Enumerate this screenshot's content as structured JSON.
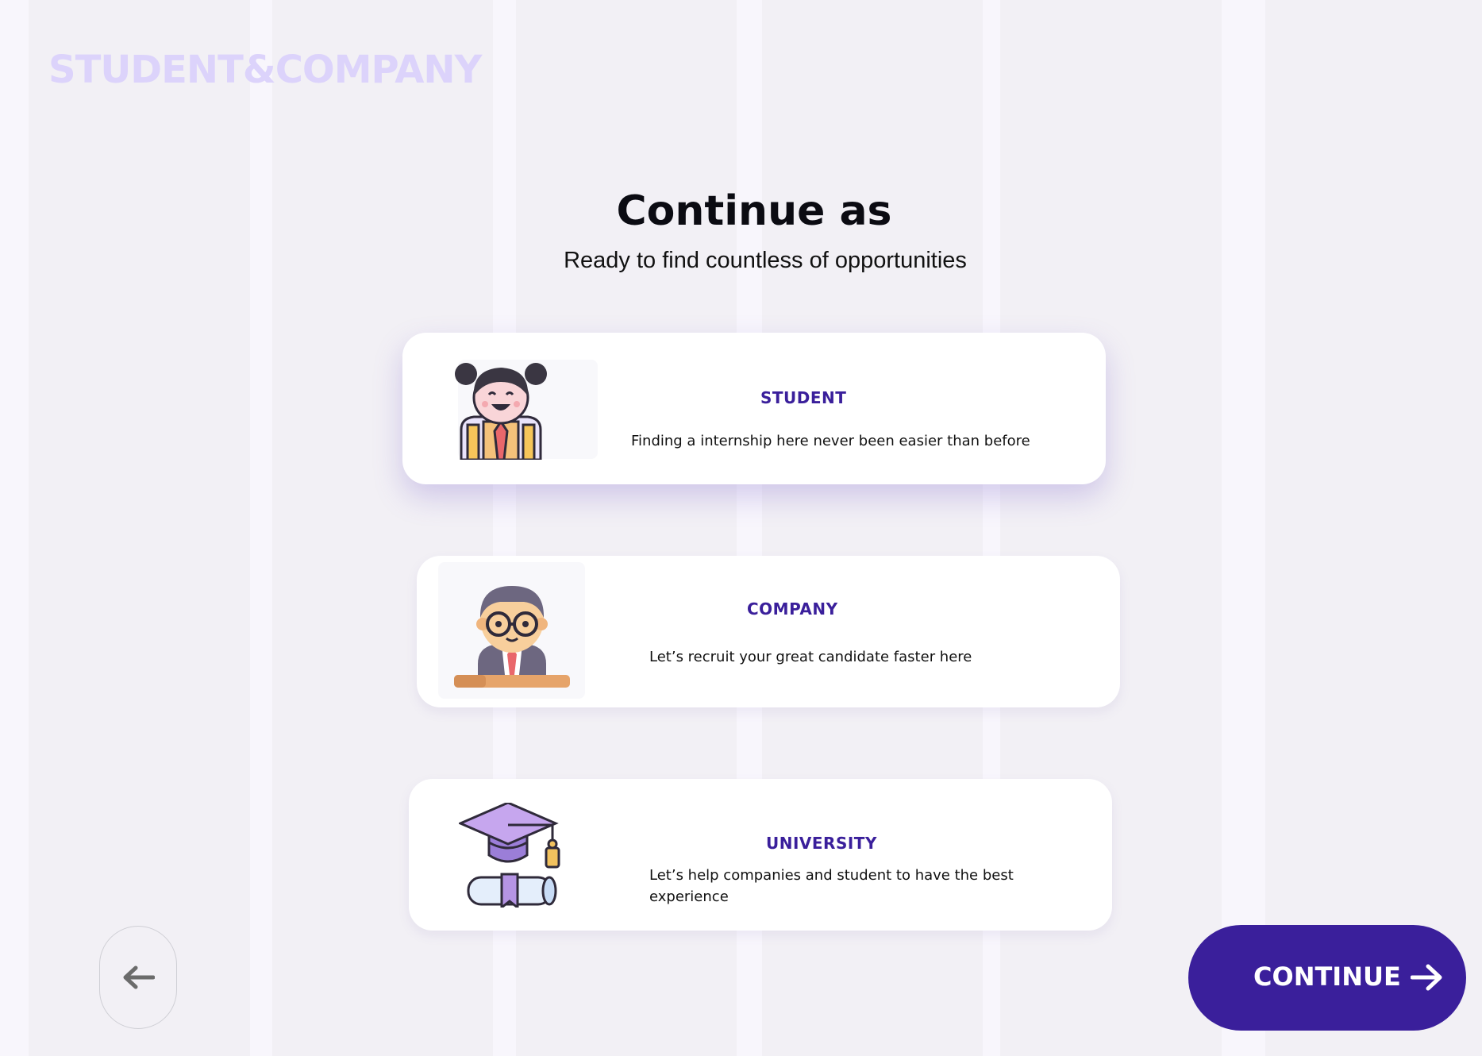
{
  "brand": {
    "logo_text": "STUDENT&COMPANY"
  },
  "header": {
    "title": "Continue as",
    "subtitle": "Ready to find countless of opportunities"
  },
  "options": [
    {
      "label": "STUDENT",
      "description": "Finding a internship here never been easier than before",
      "icon": "student-avatar-icon",
      "selected": true
    },
    {
      "label": "COMPANY",
      "description": "Let’s recruit your great candidate faster here",
      "icon": "businessman-avatar-icon",
      "selected": false
    },
    {
      "label": "UNIVERSITY",
      "description": "Let’s help companies and student to have the best experience",
      "icon": "graduation-cap-diploma-icon",
      "selected": false
    }
  ],
  "navigation": {
    "back_icon": "arrow-left-icon",
    "continue_label": "CONTINUE",
    "continue_icon": "arrow-right-icon"
  },
  "colors": {
    "accent": "#3a1f9b",
    "background": "#f2f0f5",
    "logo": "#dcd3fb",
    "card": "#ffffff"
  }
}
